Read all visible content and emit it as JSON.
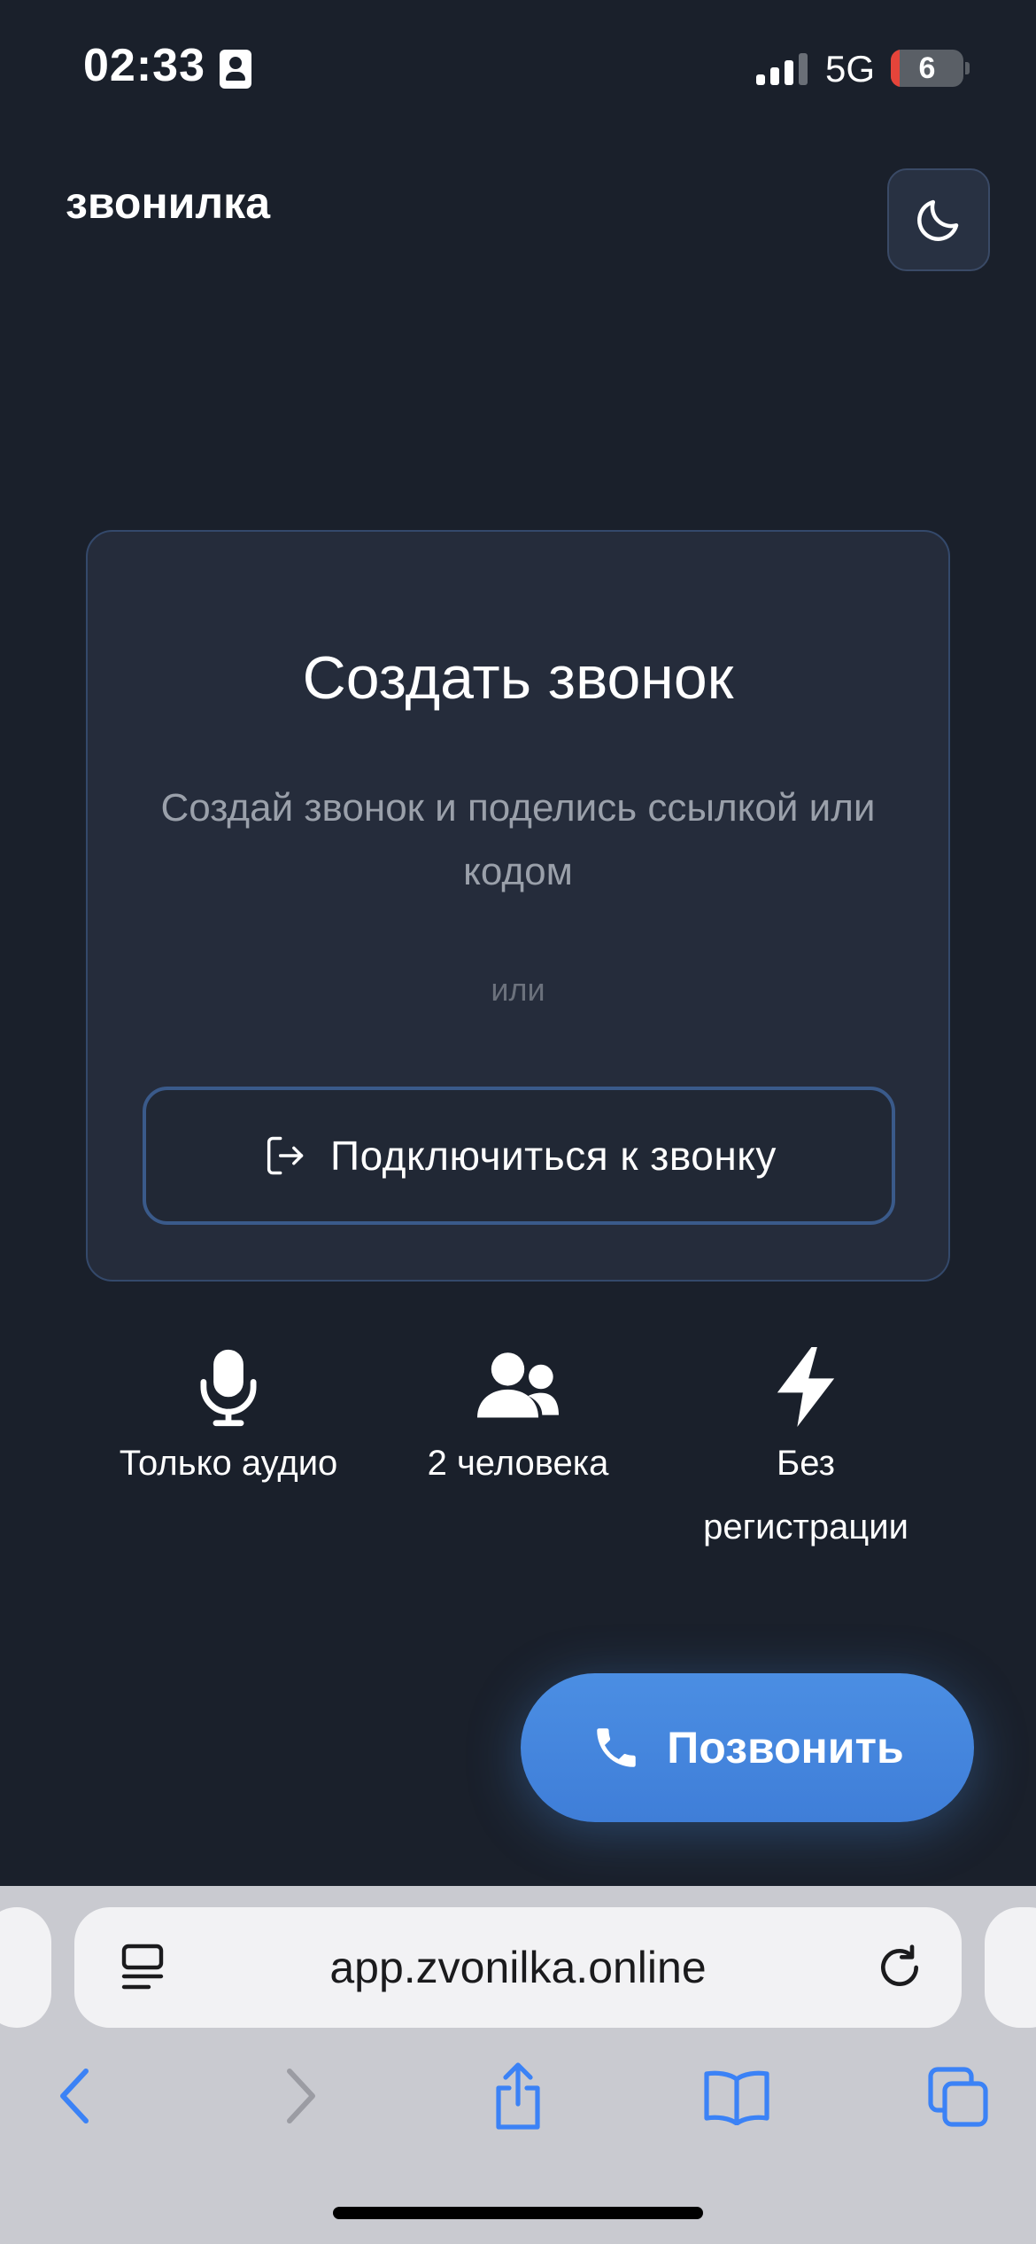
{
  "status_bar": {
    "time": "02:33",
    "network": "5G",
    "battery": "6"
  },
  "header": {
    "brand": "звонилка"
  },
  "card": {
    "title": "Создать звонок",
    "description": "Создай звонок и поделись ссылкой или кодом",
    "or_label": "или",
    "join_label": "Подключиться к звонку"
  },
  "features": [
    {
      "label": "Только аудио",
      "icon": "microphone-icon"
    },
    {
      "label": "2 человека",
      "icon": "users-icon"
    },
    {
      "label": "Без регистрации",
      "icon": "lightning-icon"
    }
  ],
  "call_button": {
    "label": "Позвонить"
  },
  "browser": {
    "url": "app.zvonilka.online"
  },
  "colors": {
    "accent": "#4a8fe4",
    "background": "#1a202b",
    "card": "#252c3b"
  }
}
